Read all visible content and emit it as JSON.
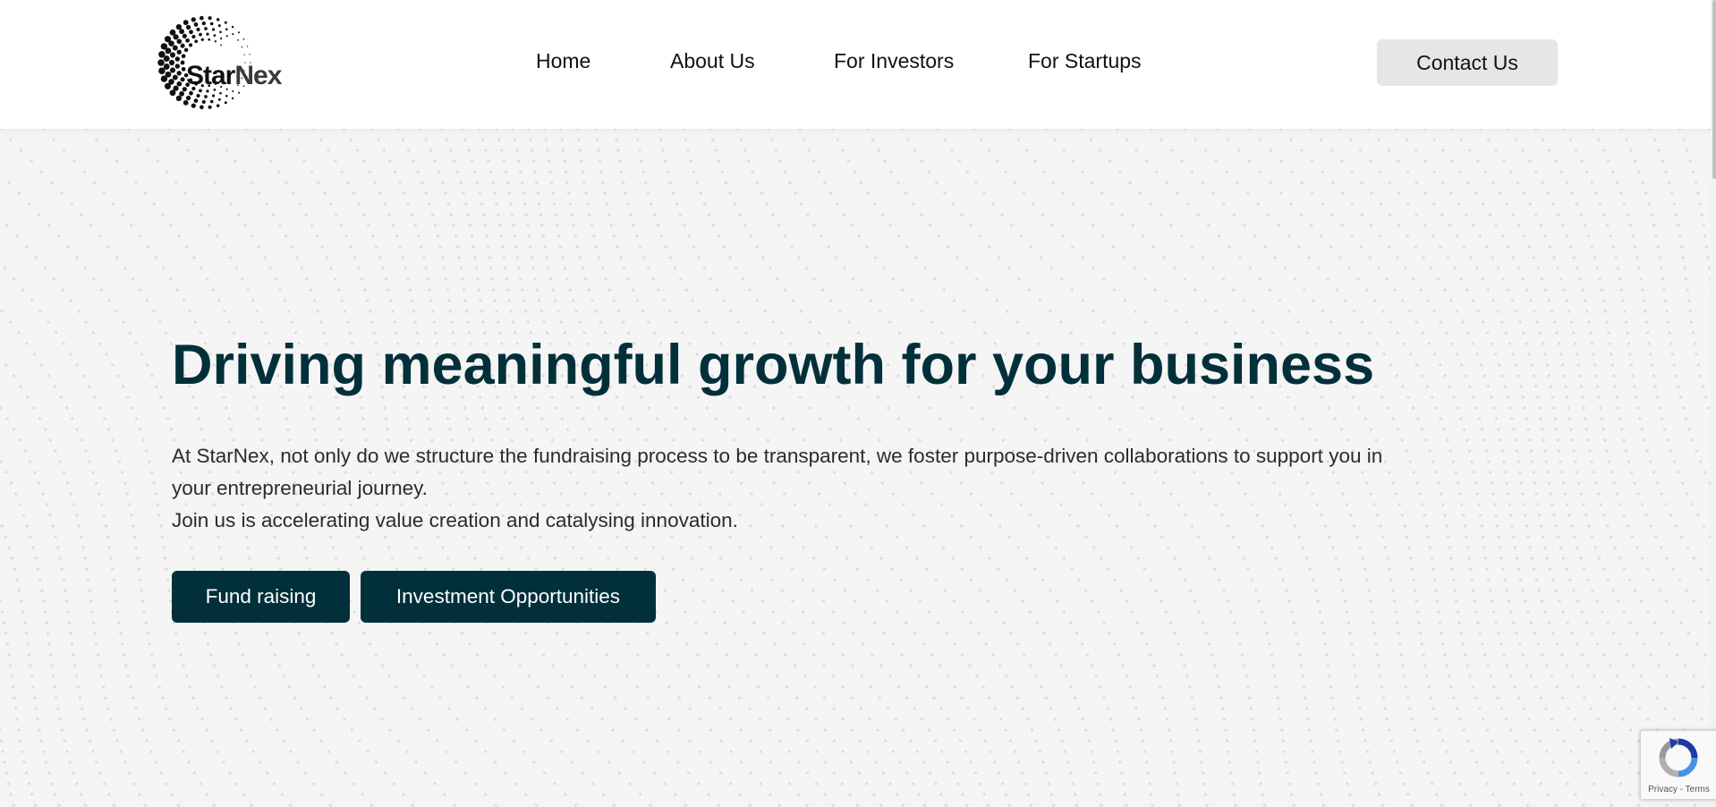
{
  "brand": {
    "name_part1": "Star",
    "name_part2": "Nex"
  },
  "nav": {
    "items": [
      {
        "label": "Home"
      },
      {
        "label": "About Us"
      },
      {
        "label": "For Investors"
      },
      {
        "label": "For Startups"
      }
    ],
    "contact_label": "Contact Us"
  },
  "hero": {
    "title": "Driving meaningful growth for your business",
    "paragraph1": "At StarNex, not only do we structure the fundraising process to be transparent, we foster purpose-driven collaborations to support you in your entrepreneurial journey.",
    "paragraph2": "Join us is accelerating value creation and catalysing innovation.",
    "buttons": [
      {
        "label": "Fund raising"
      },
      {
        "label": "Investment Opportunities"
      }
    ]
  },
  "recaptcha": {
    "links": "Privacy - Terms"
  },
  "colors": {
    "primary_dark": "#02303a",
    "header_bg": "#ffffff",
    "page_bg": "#f5f5f5",
    "contact_bg": "#e6e6e6"
  }
}
